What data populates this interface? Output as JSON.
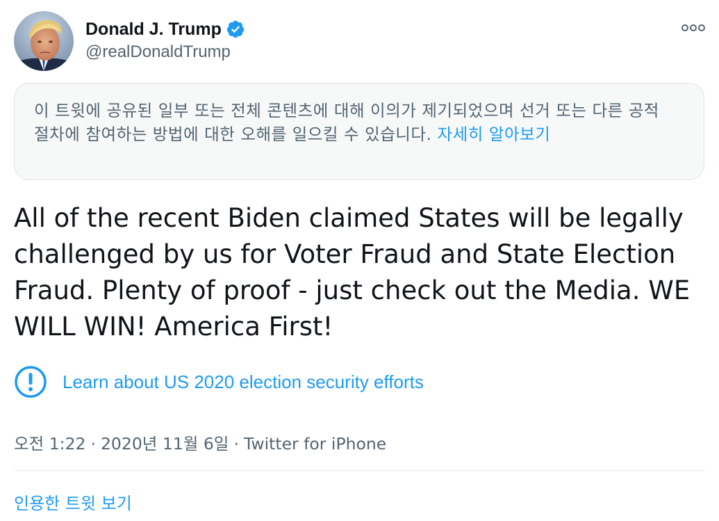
{
  "author": {
    "display_name": "Donald J. Trump",
    "handle": "@realDonaldTrump",
    "verified": true,
    "avatar_icon": "profile-photo"
  },
  "menu": {
    "more_icon": "more-dots-icon"
  },
  "notice": {
    "text": "이 트윗에 공유된 일부 또는 전체 콘텐츠에 대해 이의가 제기되었으며 선거 또는 다른 공적 절차에 참여하는 방법에 대한 오해를 일으킬 수 있습니다. ",
    "link": "자세히 알아보기"
  },
  "tweet": {
    "text": "All of the recent Biden claimed States will be legally challenged by us for Voter Fraud and State Election Fraud. Plenty of proof - just check out the Media. WE WILL WIN! America First!"
  },
  "label": {
    "icon": "exclamation-circle-icon",
    "text": "Learn about US 2020 election security efforts"
  },
  "meta": {
    "time": "오전 1:22",
    "separator": "·",
    "date": "2020년 11월 6일",
    "source": "Twitter for iPhone"
  },
  "actions": {
    "quote_tweets": "인용한 트윗 보기"
  },
  "colors": {
    "accent": "#1d9bf0",
    "text": "#0f1419",
    "secondary": "#536471",
    "notice_bg": "#f7f9f9"
  }
}
